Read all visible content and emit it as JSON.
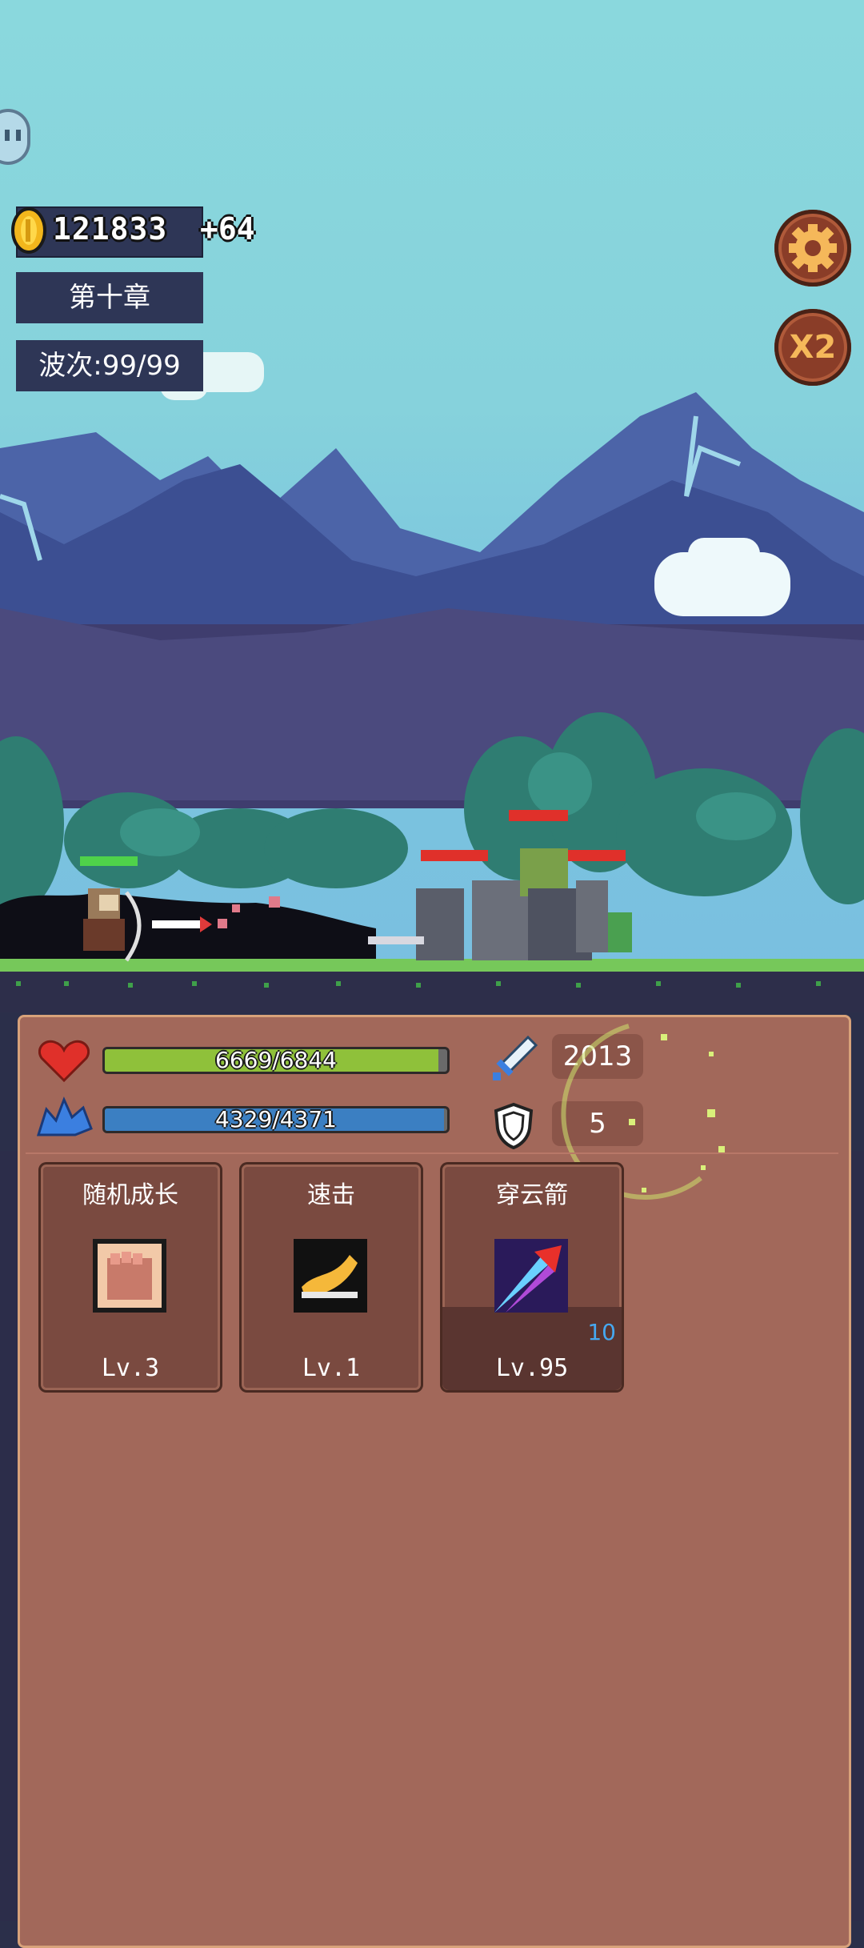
{
  "hud": {
    "gold": "121833",
    "gold_gain": "+64",
    "chapter": "第十章",
    "wave": "波次:99/99",
    "speed_label": "X2"
  },
  "stats": {
    "hp": "6669/6844",
    "hp_fraction": 0.974,
    "mp": "4329/4371",
    "mp_fraction": 0.99,
    "attack": "2013",
    "defense": "5"
  },
  "skills": [
    {
      "name": "随机成长",
      "level": "Lv.3",
      "icon": "fist-icon"
    },
    {
      "name": "速击",
      "level": "Lv.1",
      "icon": "swift-strike-icon"
    },
    {
      "name": "穿云箭",
      "level": "Lv.95",
      "icon": "arrow-icon",
      "badge": "10"
    }
  ],
  "colors": {
    "hp_bar": "#8fc13a",
    "mp_bar": "#3b7fc2",
    "panel": "#a2685a",
    "hud_box": "#2e3656"
  }
}
